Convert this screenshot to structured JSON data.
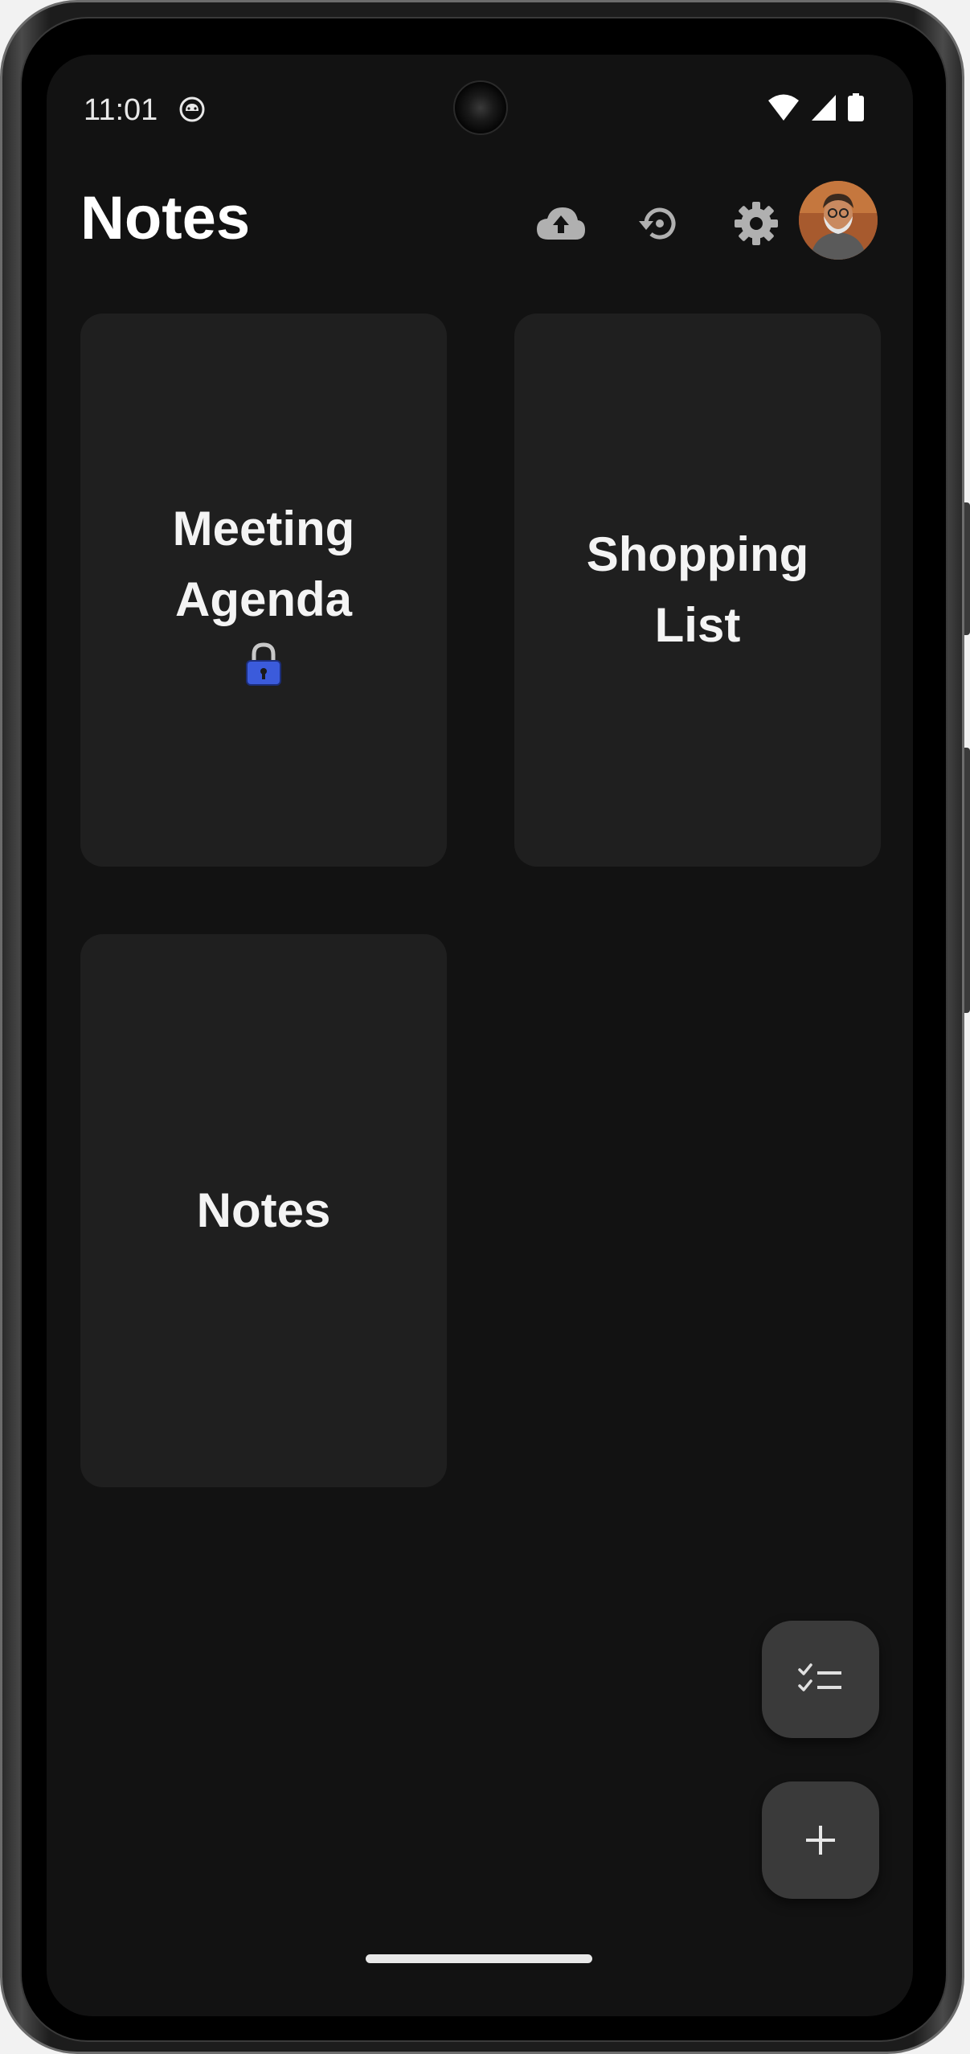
{
  "status_bar": {
    "time": "11:01",
    "icons": [
      "cat-icon",
      "wifi-icon",
      "signal-icon",
      "battery-icon"
    ]
  },
  "app_bar": {
    "title": "Notes",
    "actions": [
      "cloud-upload-icon",
      "restore-icon",
      "settings-icon",
      "avatar"
    ]
  },
  "notes": [
    {
      "title": "Meeting Agenda",
      "locked": true
    },
    {
      "title": "Shopping List",
      "locked": false
    },
    {
      "title": "Notes",
      "locked": false
    }
  ],
  "fabs": [
    {
      "icon": "checklist-icon"
    },
    {
      "icon": "plus-icon"
    }
  ],
  "colors": {
    "background": "#121212",
    "card": "#1f1f1f",
    "fab": "#3a3a3a",
    "lock": "#3b5bdb"
  }
}
